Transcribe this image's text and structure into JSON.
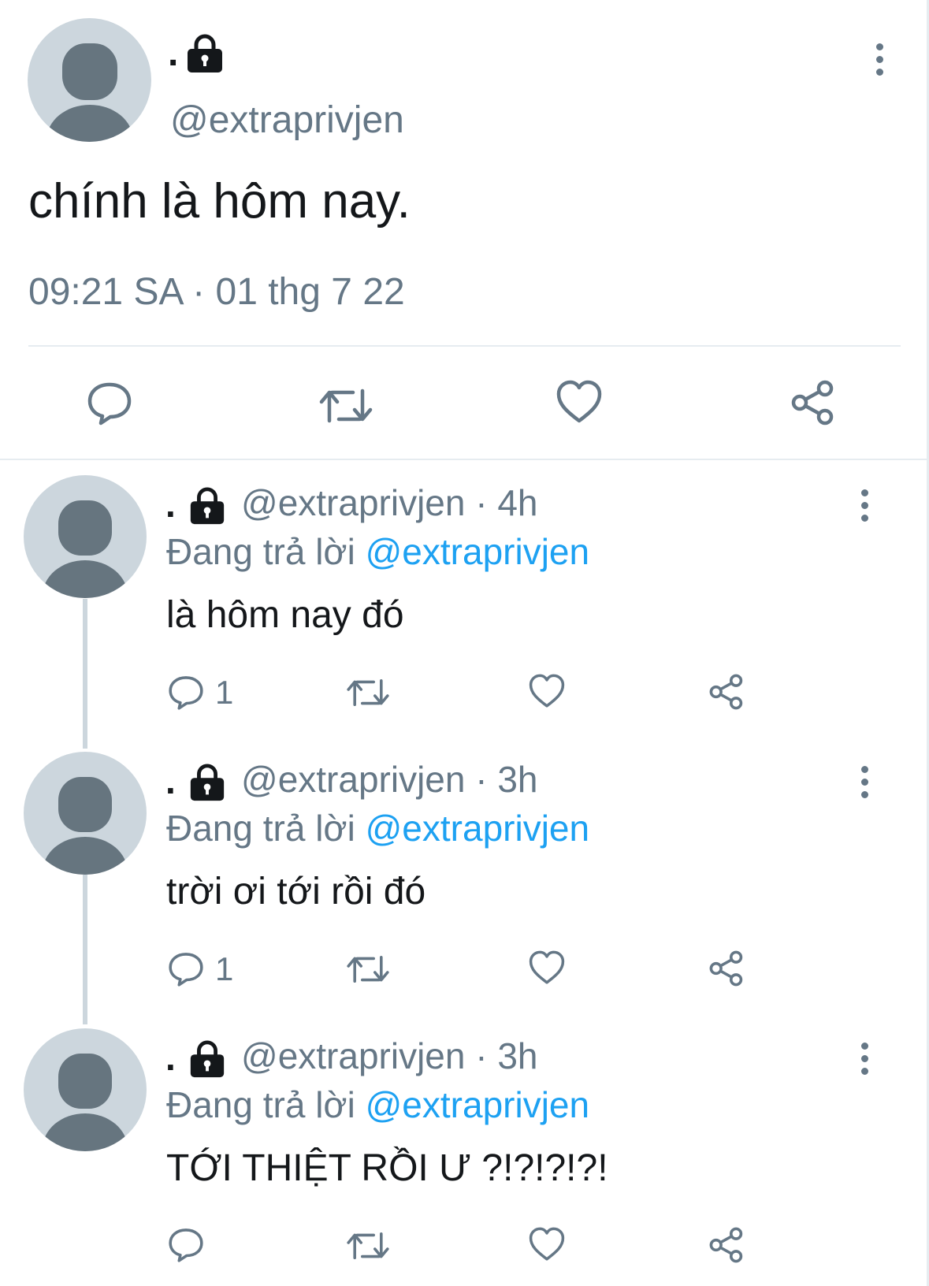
{
  "main_tweet": {
    "display_name": ".",
    "handle": "@extraprivjen",
    "text": "chính là hôm nay.",
    "timestamp": "09:21 SA · 01 thg 7 22",
    "actions": [
      "reply-icon",
      "retweet-icon",
      "like-icon",
      "share-icon"
    ]
  },
  "replies": [
    {
      "display_name": ".",
      "handle": "@extraprivjen",
      "separator_time": " · 4h",
      "replying_label": "Đang trả lời",
      "replying_to": "@extraprivjen",
      "text": "là hôm nay đó",
      "reply_count": "1"
    },
    {
      "display_name": ".",
      "handle": "@extraprivjen",
      "separator_time": " · 3h",
      "replying_label": "Đang trả lời",
      "replying_to": "@extraprivjen",
      "text": "trời ơi tới rồi đó",
      "reply_count": "1"
    },
    {
      "display_name": ".",
      "handle": "@extraprivjen",
      "separator_time": " · 3h",
      "replying_label": "Đang trả lời",
      "replying_to": "@extraprivjen",
      "text": "TỚI THIỆT RỒI Ư ?!?!?!?!",
      "reply_count": ""
    }
  ],
  "colors": {
    "text": "#14171a",
    "secondary": "#657786",
    "link": "#1da1f2",
    "avatar_bg": "#ccd6dd",
    "divider": "#e6ecf0"
  }
}
